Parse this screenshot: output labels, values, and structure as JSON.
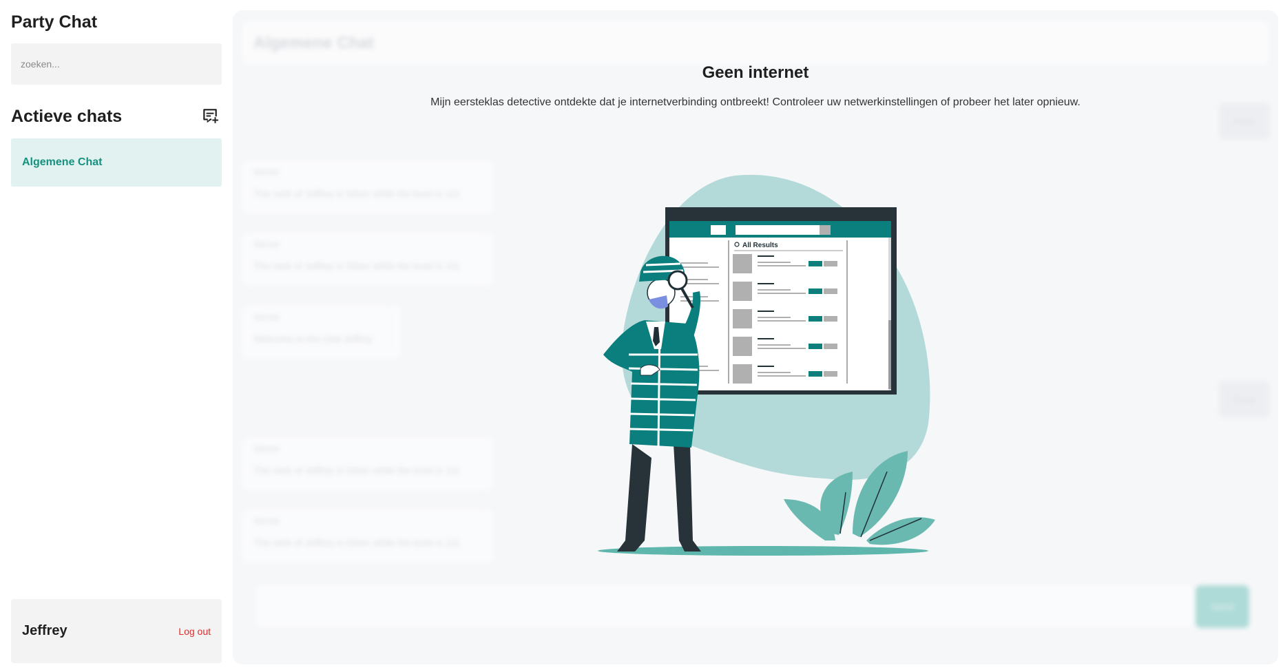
{
  "sidebar": {
    "title": "Party Chat",
    "search_placeholder": "zoeken...",
    "active_chats_title": "Actieve chats",
    "chats": [
      {
        "label": "Algemene Chat"
      }
    ],
    "user": {
      "name": "Jeffrey",
      "logout_label": "Log out"
    }
  },
  "main": {
    "chat_title": "Algemene Chat",
    "messages": [
      {
        "sender": "Server",
        "text": "The rank of Jeffrey is Silver while the level is 111"
      },
      {
        "sender": "Server",
        "text": "The rank of Jeffrey is Silver while the level is 111"
      },
      {
        "sender": "Server",
        "text": "Welcome to the chat Jeffrey"
      },
      {
        "sender": "Server",
        "text": "The rank of Jeffrey is Silver while the level is 111"
      },
      {
        "sender": "Server",
        "text": "The rank of Jeffrey is Silver while the level is 111"
      }
    ],
    "reply_label": "Reply",
    "send_label": "Send"
  },
  "offline": {
    "title": "Geen internet",
    "description": "Mijn eersteklas detective ontdekte dat je internetverbinding ontbreekt! Controleer uw netwerkinstellingen of probeer het later opnieuw.",
    "illustration_label": "All Results"
  },
  "colors": {
    "accent": "#17917f",
    "accent_bg": "#e1f2f1",
    "danger": "#e02b2b",
    "teal": "#0b7f7d",
    "blob": "#b3dad9"
  }
}
